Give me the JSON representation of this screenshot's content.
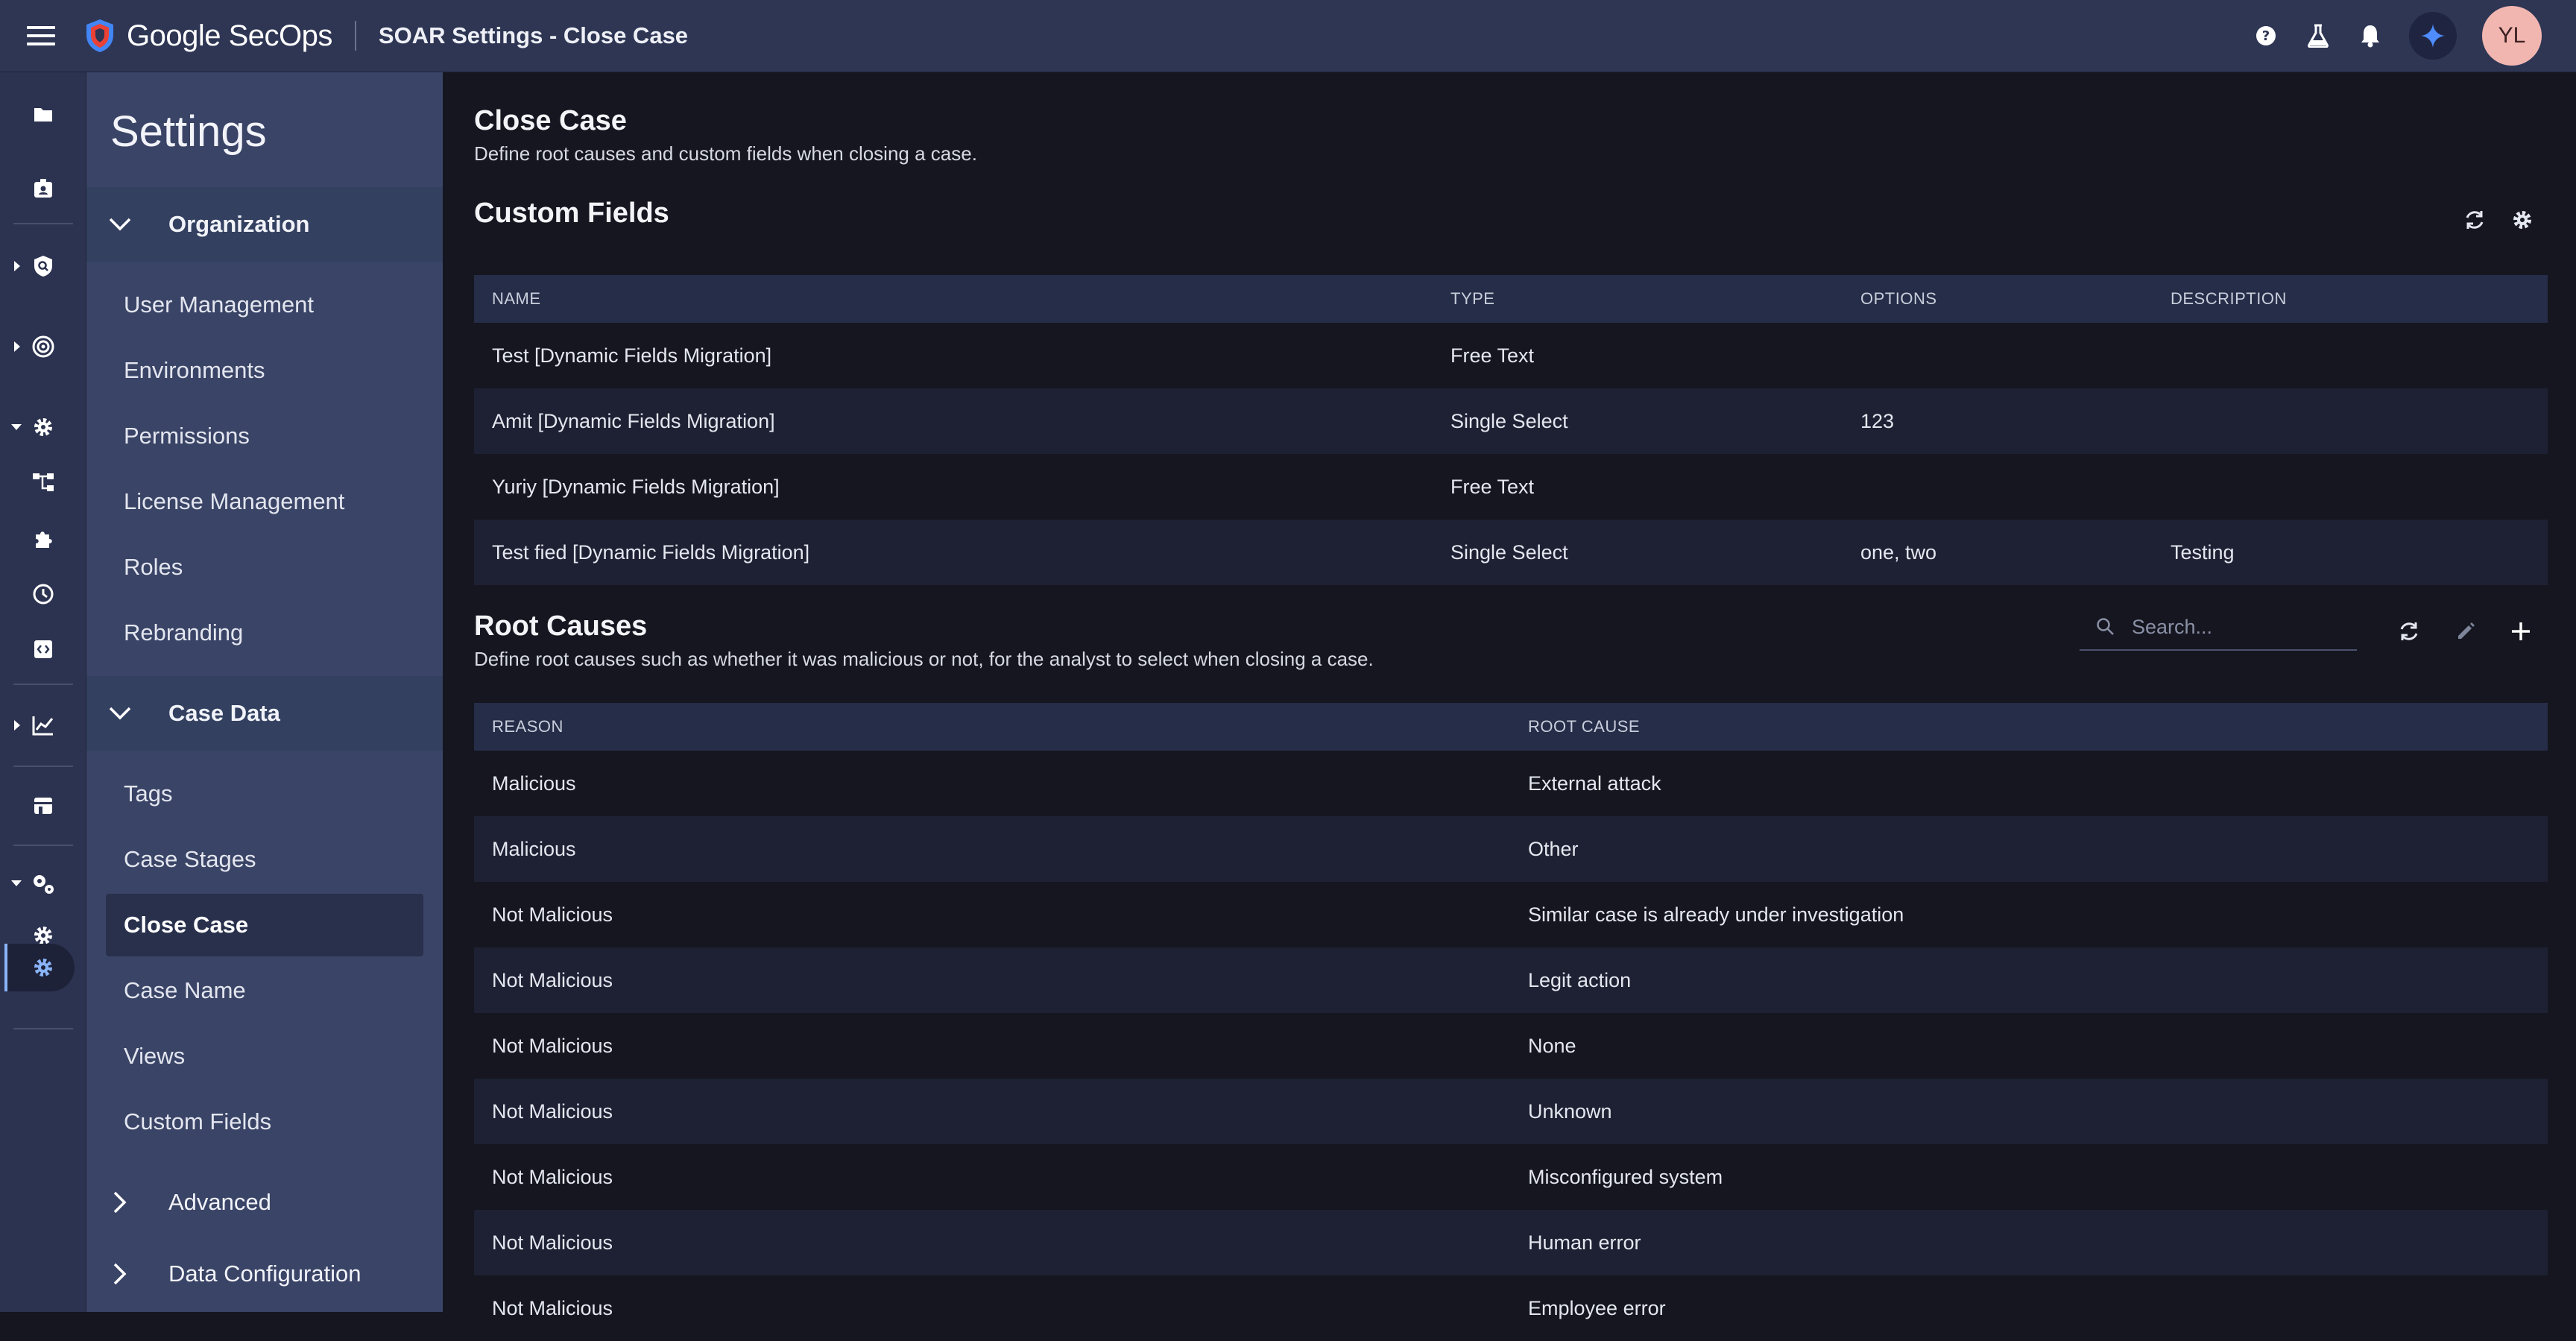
{
  "topbar": {
    "brand": "Google SecOps",
    "page_title": "SOAR Settings - Close Case",
    "avatar_initials": "YL",
    "colors": {
      "bar": "#2e3654",
      "avatar": "#f2b6b1",
      "gemini": "#4f8cff"
    }
  },
  "sidenav": {
    "title": "Settings",
    "sections": [
      {
        "label": "Organization",
        "items": [
          "User Management",
          "Environments",
          "Permissions",
          "License Management",
          "Roles",
          "Rebranding"
        ]
      },
      {
        "label": "Case Data",
        "items": [
          "Tags",
          "Case Stages",
          "Close Case",
          "Case Name",
          "Views",
          "Custom Fields"
        ]
      }
    ],
    "collapsed_sections": [
      "Advanced",
      "Data Configuration"
    ],
    "active_item": "Close Case"
  },
  "main": {
    "title": "Close Case",
    "subtitle": "Define root causes and custom fields when closing a case.",
    "custom_fields": {
      "title": "Custom Fields",
      "columns": [
        "NAME",
        "TYPE",
        "OPTIONS",
        "DESCRIPTION"
      ],
      "rows": [
        [
          "Test [Dynamic Fields Migration]",
          "Free Text",
          "",
          ""
        ],
        [
          "Amit [Dynamic Fields Migration]",
          "Single Select",
          "123",
          ""
        ],
        [
          "Yuriy [Dynamic Fields Migration]",
          "Free Text",
          "",
          ""
        ],
        [
          "Test fied [Dynamic Fields Migration]",
          "Single Select",
          "one, two",
          "Testing"
        ]
      ]
    },
    "root_causes": {
      "title": "Root Causes",
      "subtitle": "Define root causes such as whether it was malicious or not, for the analyst to select when closing a case.",
      "search_placeholder": "Search...",
      "columns": [
        "REASON",
        "ROOT CAUSE"
      ],
      "rows": [
        [
          "Malicious",
          "External attack"
        ],
        [
          "Malicious",
          "Other"
        ],
        [
          "Not Malicious",
          "Similar case is already under investigation"
        ],
        [
          "Not Malicious",
          "Legit action"
        ],
        [
          "Not Malicious",
          "None"
        ],
        [
          "Not Malicious",
          "Unknown"
        ],
        [
          "Not Malicious",
          "Misconfigured system"
        ],
        [
          "Not Malicious",
          "Human error"
        ],
        [
          "Not Malicious",
          "Employee error"
        ]
      ]
    }
  }
}
